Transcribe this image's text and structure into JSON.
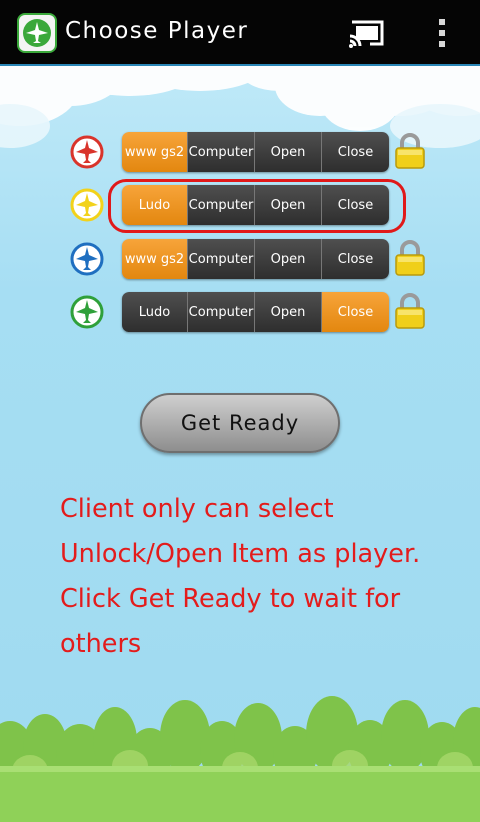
{
  "app_bar": {
    "title": "Choose Player",
    "app_icon": "airplane-icon",
    "cast_icon": "cast-icon",
    "overflow_icon": "overflow-menu-icon"
  },
  "players": [
    {
      "color": "#d9342b",
      "locked": true,
      "name": "www gs2",
      "options": [
        "Computer",
        "Open",
        "Close"
      ],
      "selected": 0
    },
    {
      "color": "#f2d21b",
      "locked": false,
      "name": "Ludo",
      "options": [
        "Computer",
        "Open",
        "Close"
      ],
      "selected": 0
    },
    {
      "color": "#1f6fc0",
      "locked": true,
      "name": "www gs2",
      "options": [
        "Computer",
        "Open",
        "Close"
      ],
      "selected": 0
    },
    {
      "color": "#2fa03a",
      "locked": true,
      "name": "Ludo",
      "options": [
        "Computer",
        "Open",
        "Close"
      ],
      "selected": 3
    }
  ],
  "get_ready_label": "Get Ready",
  "instruction_lines": [
    "Client only can select",
    "Unlock/Open Item as player.",
    "Click Get Ready to wait for",
    "others"
  ],
  "colors": {
    "selected_segment": "#f39a2a",
    "highlight_outline": "#e01919",
    "instruction_text": "#e31c1c",
    "lock": "#f0cf1a"
  }
}
